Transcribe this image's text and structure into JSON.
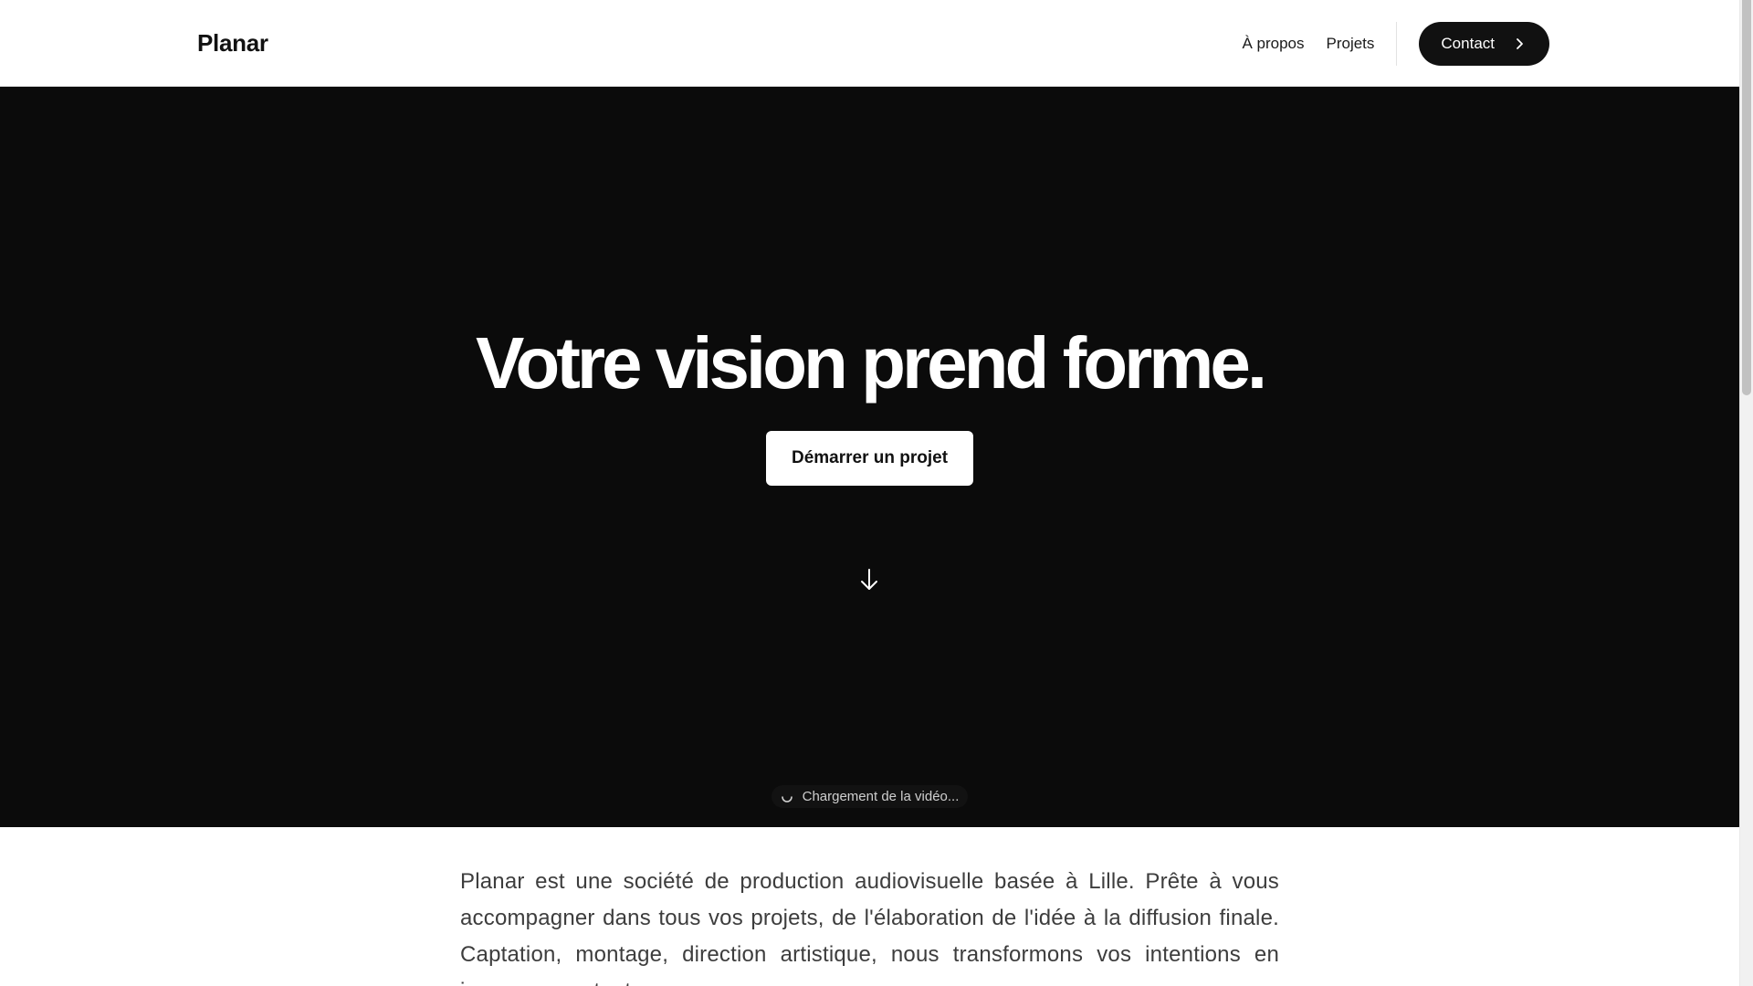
{
  "header": {
    "brand": "Planar",
    "nav": {
      "about_label": "À propos",
      "projects_label": "Projets",
      "contact_label": "Contact"
    }
  },
  "hero": {
    "title": "Votre vision prend forme.",
    "cta_label": "Démarrer un projet",
    "loading_text": "Chargement de la vidéo..."
  },
  "intro": {
    "text": "Planar est une société de production audiovisuelle basée à Lille. Prête à vous accompagner dans tous vos projets, de l'élaboration de l'idée à la diffusion finale. Captation, montage, direction artistique, nous transformons vos intentions en images percutantes."
  },
  "icons": {
    "contact_chevron": "chevron-right-icon",
    "scroll": "arrow-down-icon",
    "loading": "spinner-icon"
  },
  "colors": {
    "hero_background": "#0b0b0b",
    "accent": "#111111",
    "text_body": "#3d3d3d"
  }
}
